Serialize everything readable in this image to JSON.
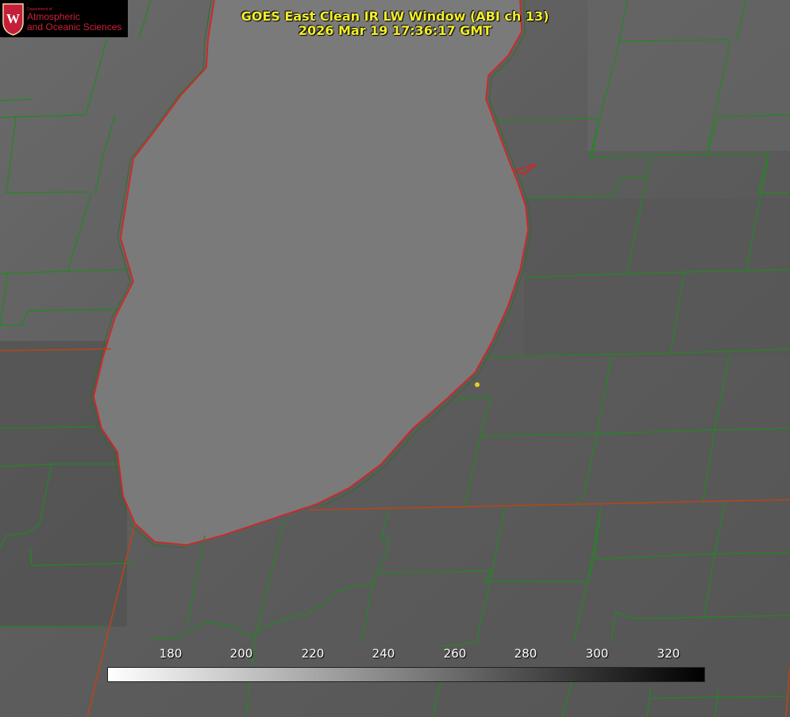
{
  "header": {
    "title_line1": "GOES East Clean IR LW Window (ABI ch 13)",
    "title_line2": "2026 Mar 19 17:36:17 GMT"
  },
  "logo": {
    "dept_small": "Department of",
    "line1": "Atmospheric",
    "line2": "and Oceanic Sciences",
    "seal_letter": "W"
  },
  "colorbar": {
    "labels": [
      "180",
      "200",
      "220",
      "240",
      "260",
      "280",
      "300",
      "320"
    ],
    "gradient_start": "#ffffff",
    "gradient_end": "#000000"
  },
  "colors": {
    "county_lines": "#1f8a1f",
    "state_lines": "#b5461a",
    "coastline": "#e02020",
    "title_text": "#f2ee2a",
    "marker": "#e8d21a",
    "logo_red": "#d0203a"
  },
  "map": {
    "features": [
      "lake",
      "coastline",
      "county-boundaries",
      "state-boundaries",
      "location-marker"
    ]
  }
}
